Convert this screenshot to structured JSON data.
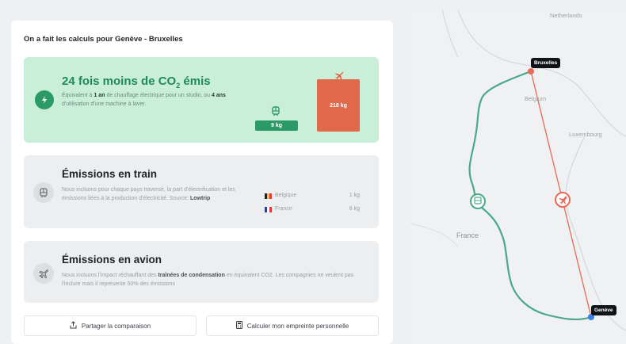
{
  "panel": {
    "title": "On a fait les calculs pour Genève - Bruxelles"
  },
  "hero": {
    "title": "24 fois moins de CO",
    "title_sub": "2",
    "title_end": " émis",
    "desc_1": "Équivalent à ",
    "desc_b1": "1 an",
    "desc_2": " de chauffage électrique pour un studio, ou ",
    "desc_b2": "4 ans",
    "desc_3": " d'utilisation d'une machine à laver.",
    "train_value": "9 kg",
    "plane_value": "218 kg"
  },
  "train_card": {
    "title": "Émissions en train",
    "desc_1": "Nous incluons pour chaque pays traversé, la part d'électrification et les émissions liées à la production d'électricité. Source: ",
    "desc_b": "Lowtrip",
    "countries": [
      {
        "name": "Belgique",
        "value": "1 kg"
      },
      {
        "name": "France",
        "value": "8 kg"
      }
    ]
  },
  "plane_card": {
    "title": "Émissions en avion",
    "desc_1": "Nous incluons l'impact réchauffant des ",
    "desc_b": "traînées de condensation",
    "desc_2": " en équivalent CO2. Les compagnies ne veulent pas l'inclure mais il représente 50% des émissions"
  },
  "buttons": {
    "share": "Partager la comparaison",
    "calc": "Calculer mon empreinte personnelle"
  },
  "map": {
    "labels": {
      "netherlands": "Netherlands",
      "belgium": "Belgium",
      "luxembourg": "Luxembourg",
      "france": "France"
    },
    "cities": {
      "origin": "Genève",
      "destination": "Bruxelles"
    }
  },
  "colors": {
    "train_green": "#2c9a67",
    "plane_red": "#e2684c",
    "hero_bg": "#c9efd9"
  },
  "icons": [
    "bolt-icon",
    "train-icon",
    "plane-icon",
    "share-icon",
    "calculator-icon"
  ]
}
